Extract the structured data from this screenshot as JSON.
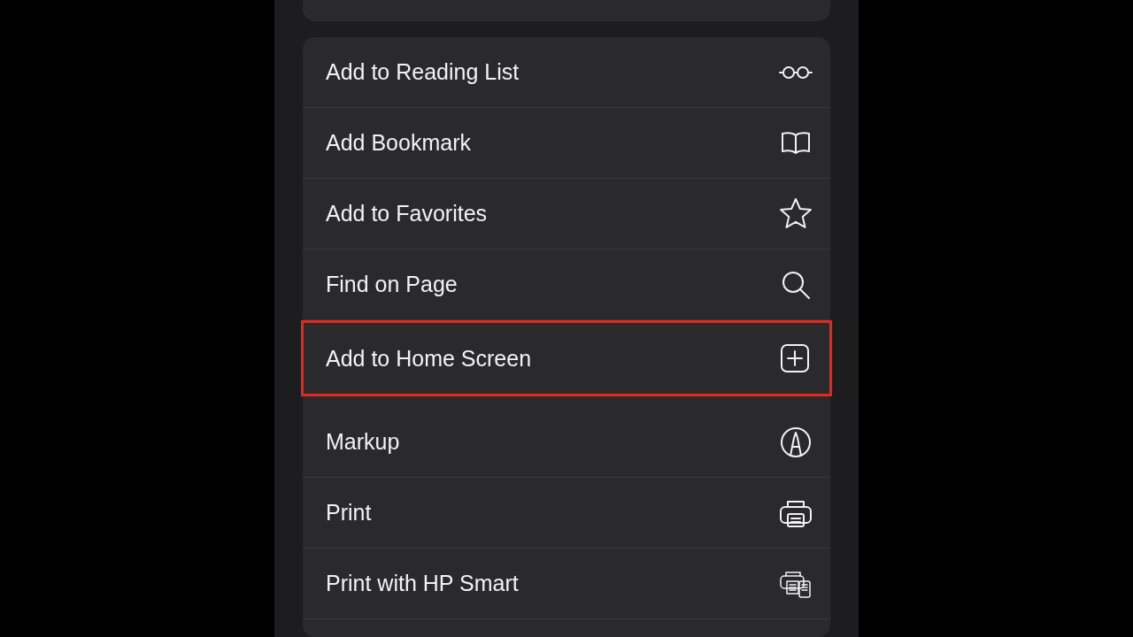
{
  "actions": [
    {
      "label": "Add to Reading List",
      "kind": "glasses",
      "selected": false
    },
    {
      "label": "Add Bookmark",
      "kind": "book",
      "selected": false
    },
    {
      "label": "Add to Favorites",
      "kind": "star",
      "selected": false
    },
    {
      "label": "Find on Page",
      "kind": "search",
      "selected": false
    },
    {
      "label": "Add to Home Screen",
      "kind": "add",
      "selected": true
    },
    {
      "label": "Markup",
      "kind": "markup",
      "selected": false
    },
    {
      "label": "Print",
      "kind": "print",
      "selected": false
    },
    {
      "label": "Print with HP Smart",
      "kind": "app",
      "selected": false
    }
  ]
}
